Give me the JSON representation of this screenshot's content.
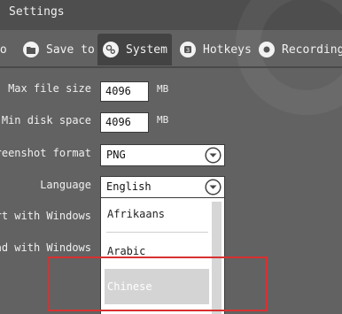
{
  "window": {
    "title": "Settings"
  },
  "tabs": [
    {
      "label": "io",
      "icon": "audio-icon"
    },
    {
      "label": "Save to",
      "icon": "folder-icon"
    },
    {
      "label": "System",
      "icon": "gear-icon",
      "active": true
    },
    {
      "label": "Hotkeys",
      "icon": "hotkey-icon"
    },
    {
      "label": "Recording",
      "icon": "record-icon"
    }
  ],
  "settings": {
    "max_file_size": {
      "label": "Max file size",
      "value": "4096",
      "unit": "MB"
    },
    "min_disk_space": {
      "label": "Min disk space",
      "value": "4096",
      "unit": "MB"
    },
    "screenshot_format": {
      "label": "reenshot format",
      "value": "PNG"
    },
    "language": {
      "label": "Language",
      "value": "English"
    },
    "start_with_windows": {
      "label": "rt with Windows"
    },
    "load_with_windows": {
      "label": "ad with Windows"
    }
  },
  "language_dropdown": {
    "options": [
      "Afrikaans",
      "Arabic",
      "Chinese"
    ],
    "highlighted": "Chinese"
  },
  "colors": {
    "background": "#626262",
    "titlebar": "#4e4e4e",
    "active_tab": "#434343",
    "highlight_border": "#d93030"
  }
}
